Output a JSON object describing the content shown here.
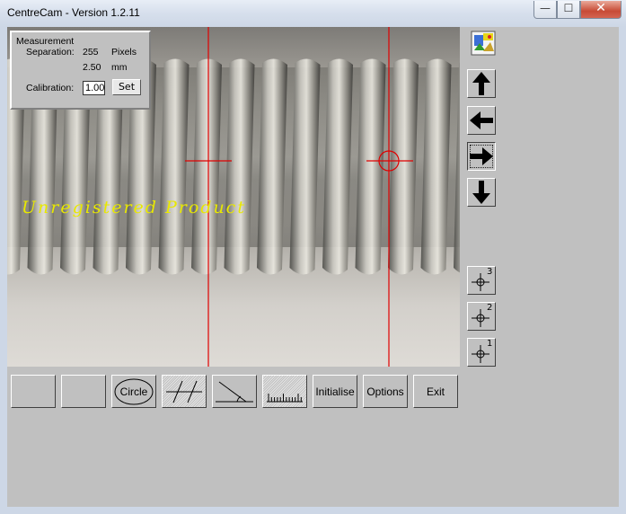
{
  "window": {
    "title": "CentreCam - Version 1.2.11",
    "controls": {
      "minimize": "—",
      "maximize": "☐",
      "close": "✕"
    }
  },
  "overlay": {
    "watermark": "Unregistered Product",
    "line_color": "#e00000",
    "watermark_color": "#e8e800"
  },
  "measurement": {
    "heading": "Measurement",
    "separation_label": "Separation:",
    "separation_value": "255",
    "separation_unit": "Pixels",
    "mm_value": "2.50",
    "mm_unit": "mm",
    "calibration_label": "Calibration:",
    "calibration_value": "1.00",
    "set_label": "Set"
  },
  "side_buttons": {
    "icons": [
      "camera-settings-icon",
      "arrow-up-icon",
      "arrow-left-icon",
      "arrow-right-icon",
      "arrow-down-icon"
    ],
    "crosshair_labels": [
      "3",
      "2",
      "1"
    ]
  },
  "toolbar": {
    "circle_label": "Circle",
    "initialise_label": "Initialise",
    "options_label": "Options",
    "exit_label": "Exit"
  }
}
